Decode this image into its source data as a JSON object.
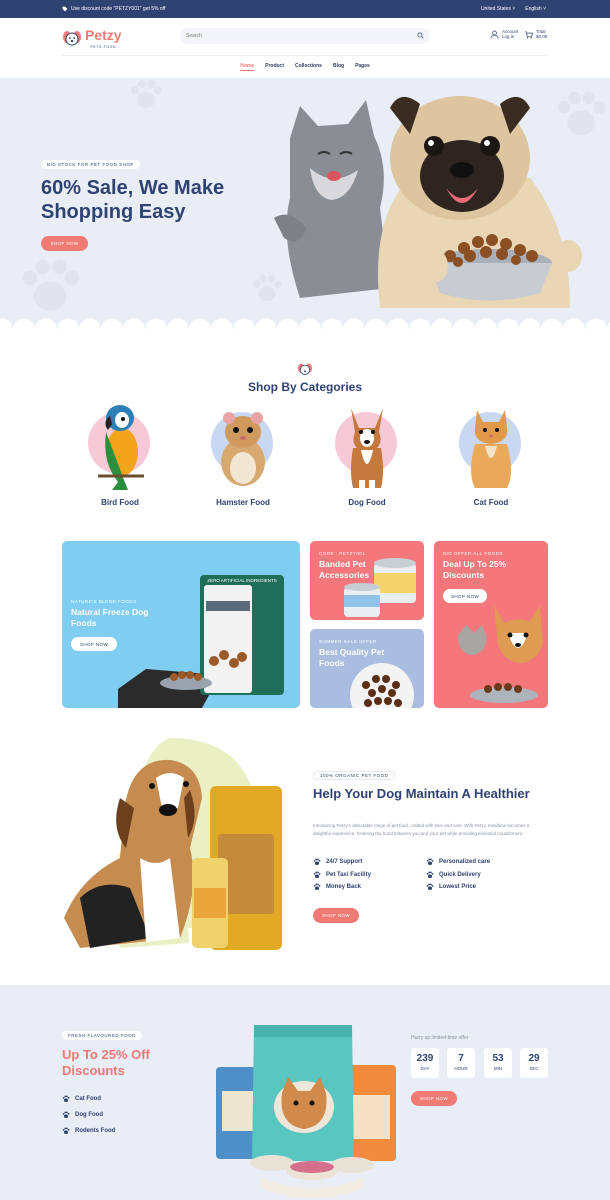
{
  "topbar": {
    "promo": "Use discount code \"PETZY001\" get 5% off",
    "country": "United States",
    "language": "English"
  },
  "header": {
    "logo": "Petzy",
    "logo_sub": "PETS FOOD",
    "search_placeholder": "Search",
    "account_line1": "Account",
    "account_line2": "Log in",
    "cart_line1": "Total",
    "cart_line2": "$0.00"
  },
  "nav": [
    "Home",
    "Product",
    "Collections",
    "Blog",
    "Pages"
  ],
  "hero": {
    "tag": "BIG STOCK FOR PET FOOD SHOP",
    "title": "60% Sale, We Make Shopping Easy",
    "button": "SHOP NOW"
  },
  "categories": {
    "title": "Shop By Categories",
    "items": [
      {
        "label": "Bird Food",
        "blob": "#f6c9d6"
      },
      {
        "label": "Hamster Food",
        "blob": "#c9d8f2"
      },
      {
        "label": "Dog Food",
        "blob": "#f6c9d6"
      },
      {
        "label": "Cat Food",
        "blob": "#c9d8f2"
      }
    ]
  },
  "banners": {
    "b1": {
      "tag": "NATURE'S BLEND FOODS",
      "title": "Natural Freeze Dog Foods",
      "button": "SHOP NOW",
      "package_text": "ZERO ARTIFICIAL INGREDIENTS"
    },
    "b2": {
      "tag": "CODE : PETZY001",
      "title": "Banded Pet Accessories"
    },
    "b3": {
      "tag": "SUMMER SALE OFFER",
      "title": "Best Quality Pet Foods"
    },
    "b4": {
      "tag": "BIG OFFER ALL FOODS",
      "title": "Deal Up To 25% Discounts",
      "button": "SHOP NOW"
    }
  },
  "feature": {
    "tag": "100% ORGANIC PET FOOD",
    "title": "Help Your Dog Maintain A Healthier",
    "description": "Introducing Petzy's delectable range of pet food, crafted with love and care. With Petzy, mealtime becomes a delightful experience, fostering the bond between you and your pet while providing essential nourishment.",
    "list_left": [
      "24/7 Support",
      "Pet Taxi Facility",
      "Money Back"
    ],
    "list_right": [
      "Personalized care",
      "Quick Delivery",
      "Lowest Price"
    ],
    "button": "SHOP NOW"
  },
  "promo": {
    "tag": "FRESH FLAVOURED FOOD",
    "title": "Up To 25% Off Discounts",
    "list": [
      "Cat Food",
      "Dog Food",
      "Rodents Food"
    ],
    "hurry": "Hurry up limited-time offer",
    "countdown": [
      {
        "value": "239",
        "unit": "DAY"
      },
      {
        "value": "7",
        "unit": "HOUR"
      },
      {
        "value": "53",
        "unit": "MIN"
      },
      {
        "value": "29",
        "unit": "SEC"
      }
    ],
    "button": "SHOP NOW"
  }
}
